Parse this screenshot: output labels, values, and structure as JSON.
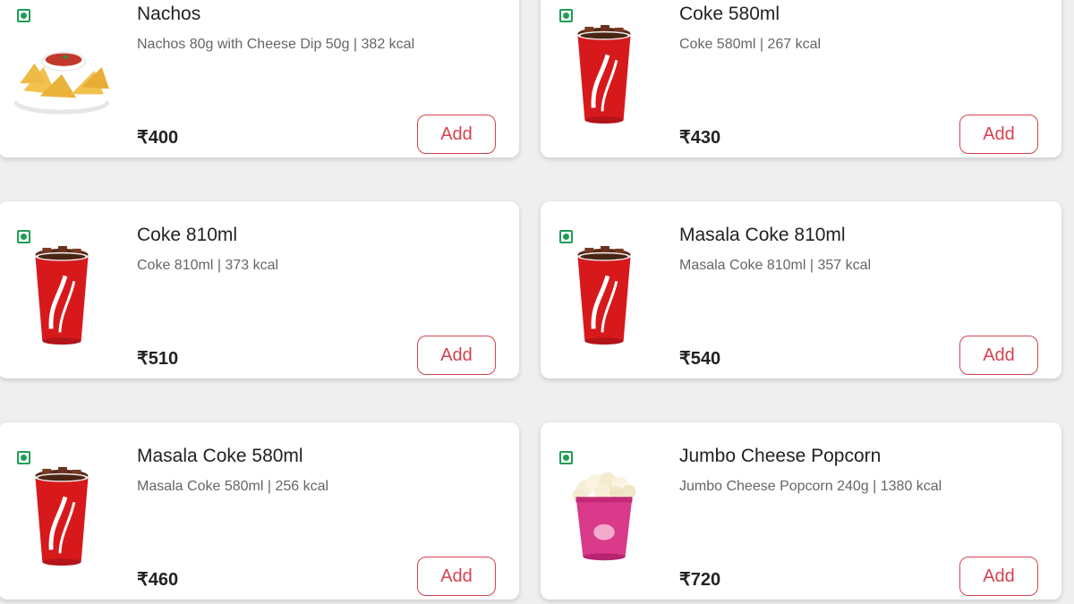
{
  "items": [
    {
      "name": "Nachos",
      "description": "Nachos 80g with Cheese Dip 50g | 382 kcal",
      "price": "₹400",
      "add_label": "Add",
      "icon": "nachos-icon"
    },
    {
      "name": "Coke 580ml",
      "description": "Coke 580ml | 267 kcal",
      "price": "₹430",
      "add_label": "Add",
      "icon": "cola-cup-icon"
    },
    {
      "name": "Coke 810ml",
      "description": "Coke 810ml | 373 kcal",
      "price": "₹510",
      "add_label": "Add",
      "icon": "cola-cup-icon"
    },
    {
      "name": "Masala Coke 810ml",
      "description": "Masala Coke 810ml | 357 kcal",
      "price": "₹540",
      "add_label": "Add",
      "icon": "cola-cup-icon"
    },
    {
      "name": "Masala Coke 580ml",
      "description": "Masala Coke 580ml | 256 kcal",
      "price": "₹460",
      "add_label": "Add",
      "icon": "cola-cup-icon"
    },
    {
      "name": "Jumbo Cheese Popcorn",
      "description": "Jumbo Cheese Popcorn 240g | 1380 kcal",
      "price": "₹720",
      "add_label": "Add",
      "icon": "popcorn-tub-icon"
    }
  ],
  "colors": {
    "accent": "#d4434f",
    "veg": "#1f9d55",
    "background": "#efefef"
  }
}
